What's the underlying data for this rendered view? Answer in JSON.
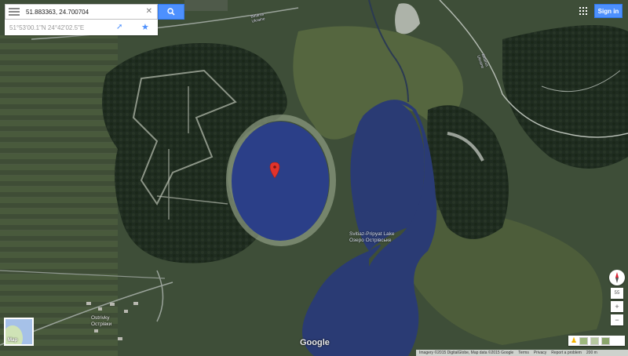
{
  "search": {
    "query": "51.883363, 24.700704"
  },
  "coords_card": {
    "dms": "51°53'00.1\"N 24°42'02.5\"E"
  },
  "header": {
    "signin_label": "Sign in"
  },
  "map": {
    "road_label_a": "Belarus\nUkraine",
    "road_label_b": "Belarus\nUkraine",
    "lake_label": "Svitiaz-Pripyat Lake\nОзеро Острівське",
    "village_label": "Ostrivky\nОстрівки",
    "google_logo": "Google",
    "minimap_label": "Map"
  },
  "controls": {
    "zoom_level": "55",
    "zoom_in": "+",
    "zoom_out": "−"
  },
  "footer": {
    "imagery": "Imagery ©2015 DigitalGlobe, Map data ©2015 Google",
    "terms": "Terms",
    "privacy": "Privacy",
    "report": "Report a problem",
    "scale": "200 m"
  },
  "colors": {
    "lake": "#2b3f88",
    "search_button": "#4d90fe",
    "marker": "#e2332b"
  },
  "icons": [
    "menu-icon",
    "close-icon",
    "search-icon",
    "directions-icon",
    "star-icon",
    "apps-icon",
    "marker-icon",
    "compass-icon"
  ]
}
